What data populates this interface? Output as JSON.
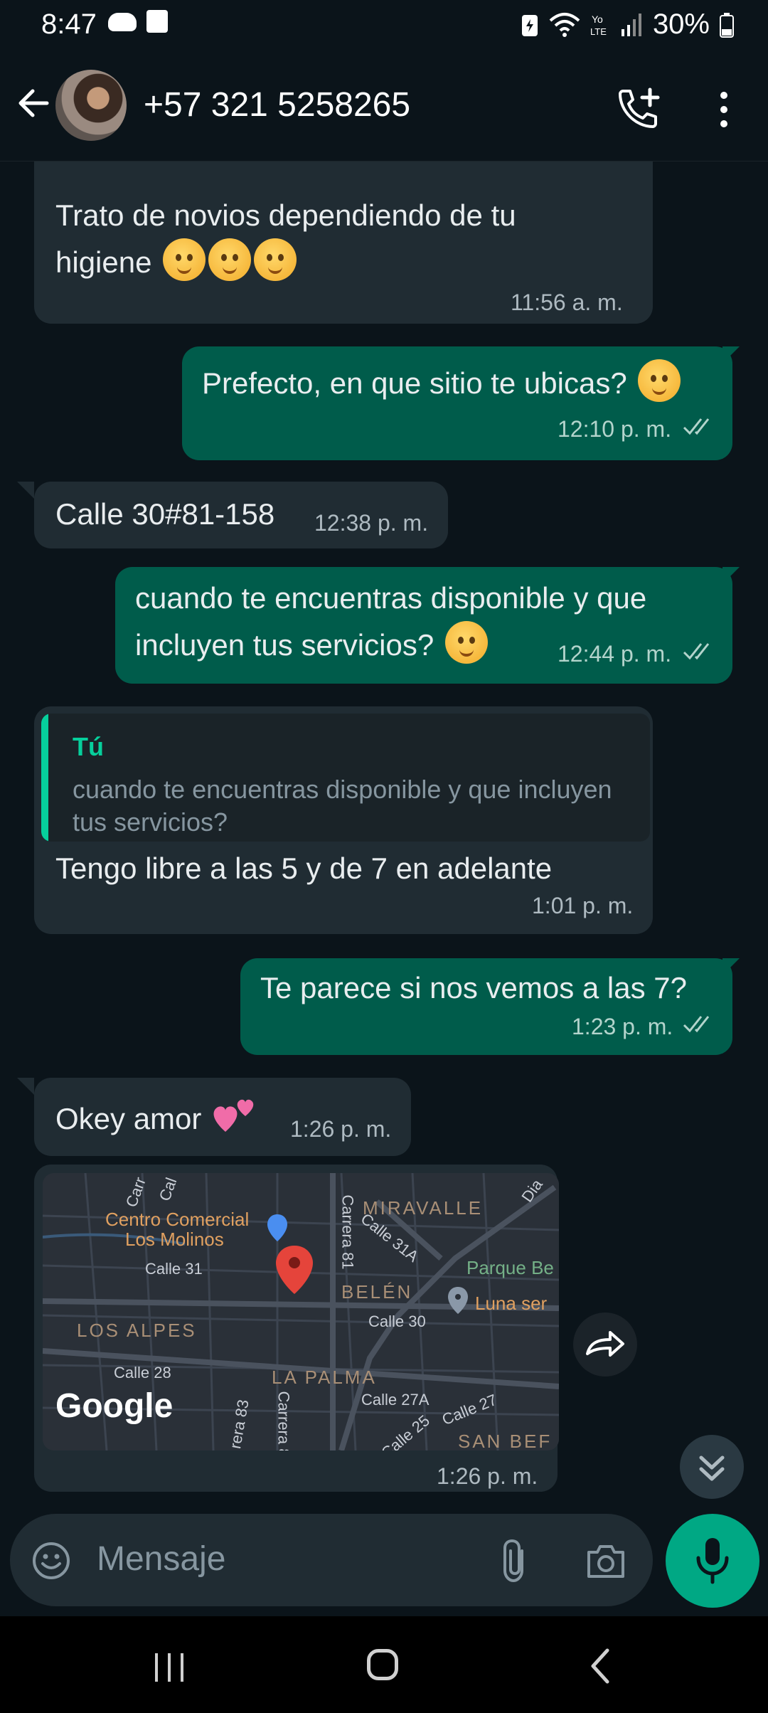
{
  "status_bar": {
    "time": "8:47",
    "battery": "30%"
  },
  "header": {
    "contact": "+57 321 5258265"
  },
  "messages": [
    {
      "id": "m1",
      "type": "in",
      "text_line1": "Trato de novios dependiendo de tu",
      "text_line2": "higiene",
      "time": "11:56 a. m."
    },
    {
      "id": "m2",
      "type": "out",
      "text": "Prefecto, en que sitio te ubicas?",
      "time": "12:10 p. m."
    },
    {
      "id": "m3",
      "type": "in",
      "text": "Calle 30#81-158",
      "time": "12:38 p. m."
    },
    {
      "id": "m4",
      "type": "out",
      "text_line1": "cuando te encuentras disponible y que",
      "text_line2": "incluyen tus servicios?",
      "time": "12:44 p. m."
    },
    {
      "id": "m5",
      "type": "in",
      "quote_author": "Tú",
      "quote_text": "cuando te encuentras disponible y que incluyen tus servicios?",
      "text": "Tengo libre a las 5 y de 7 en adelante",
      "time": "1:01 p. m."
    },
    {
      "id": "m6",
      "type": "out",
      "text": "Te parece si nos vemos a las 7?",
      "time": "1:23 p. m."
    },
    {
      "id": "m7",
      "type": "in",
      "text": "Okey amor",
      "time": "1:26 p. m."
    },
    {
      "id": "m8",
      "type": "in-location",
      "time": "1:26 p. m."
    }
  ],
  "map": {
    "labels": {
      "poi_name_1": "Centro Comercial",
      "poi_name_2": "Los Molinos",
      "miravalle": "MIRAVALLE",
      "parque": "Parque Be",
      "belen": "BELÉN",
      "luna": "Luna ser",
      "los_alpes": "LOS ALPES",
      "la_palma": "LA PALMA",
      "san_ber": "SAN BEF",
      "calle31": "Calle 31",
      "calle31a": "Calle 31A",
      "calle30": "Calle 30",
      "calle28": "Calle 28",
      "calle27a": "Calle 27A",
      "calle27": "Calle 27",
      "calle25": "Calle 25",
      "carrera81": "Carrera 81",
      "carrera83": "rera 83",
      "carrera8x": "Carrera 8",
      "carr": "Carr",
      "cal": "Cal",
      "dia": "Dia"
    },
    "attribution": "Google"
  },
  "input": {
    "placeholder": "Mensaje"
  },
  "colors": {
    "incoming": "#202c33",
    "outgoing": "#005c4b",
    "accent": "#00a884",
    "background": "#0b141a"
  }
}
